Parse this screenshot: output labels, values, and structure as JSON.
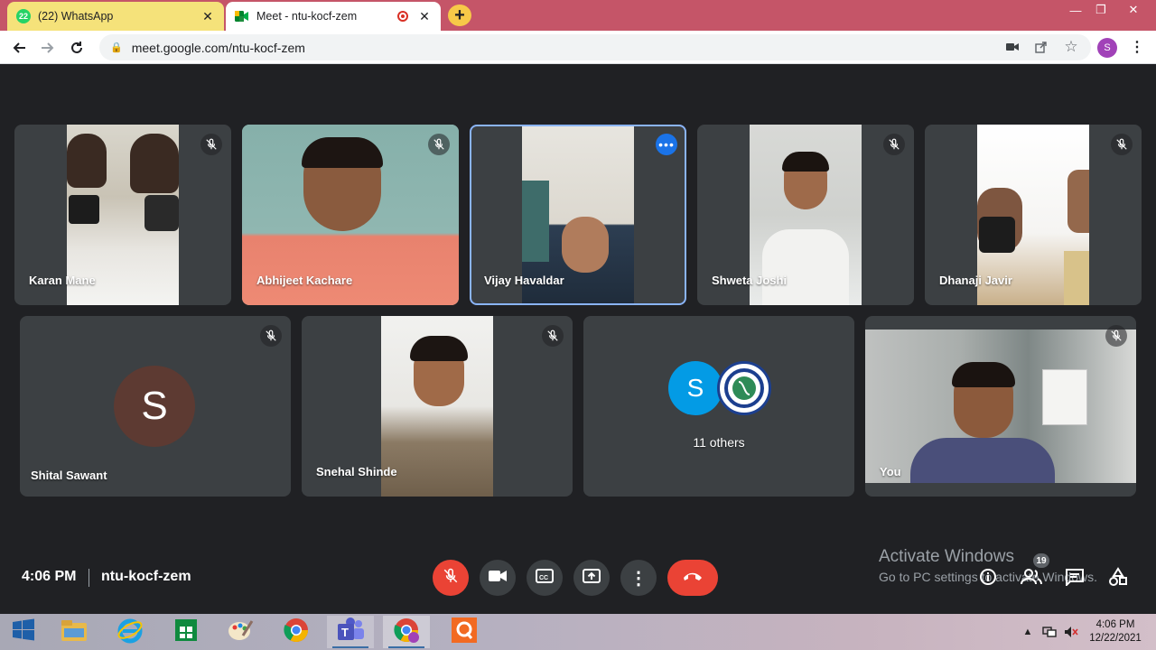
{
  "browser": {
    "tabs": [
      {
        "title": "(22) WhatsApp",
        "badge": "22"
      },
      {
        "title": "Meet - ntu-kocf-zem"
      }
    ],
    "url": "meet.google.com/ntu-kocf-zem",
    "profile_initial": "S"
  },
  "meet": {
    "participants_top": [
      {
        "name": "Karan Mane"
      },
      {
        "name": "Abhijeet Kachare"
      },
      {
        "name": "Vijay Havaldar"
      },
      {
        "name": "Shweta Joshi"
      },
      {
        "name": "Dhanaji Javir"
      }
    ],
    "participants_bottom": [
      {
        "name": "Shital Sawant",
        "initial": "S",
        "avatar_color": "#5d3a32"
      },
      {
        "name": "Snehal Shinde"
      },
      {
        "name": "11 others",
        "initial": "S",
        "avatar_color": "#039be5"
      },
      {
        "name": "You"
      }
    ],
    "time": "4:06 PM",
    "meeting_code": "ntu-kocf-zem",
    "people_count": "19",
    "accent_colors": {
      "end_call": "#ea4335",
      "active_speaker": "#8ab4f8"
    }
  },
  "windows": {
    "activate_title": "Activate Windows",
    "activate_sub": "Go to PC settings to activate Windows.",
    "clock_time": "4:06 PM",
    "clock_date": "12/22/2021"
  },
  "icons": {
    "mic_off": "mic-off-icon",
    "camera": "camera-icon",
    "captions": "captions-icon",
    "present": "present-icon",
    "more": "more-vert-icon",
    "end_call": "end-call-icon",
    "info": "info-icon",
    "people": "people-icon",
    "chat": "chat-icon",
    "activities": "activities-icon"
  }
}
